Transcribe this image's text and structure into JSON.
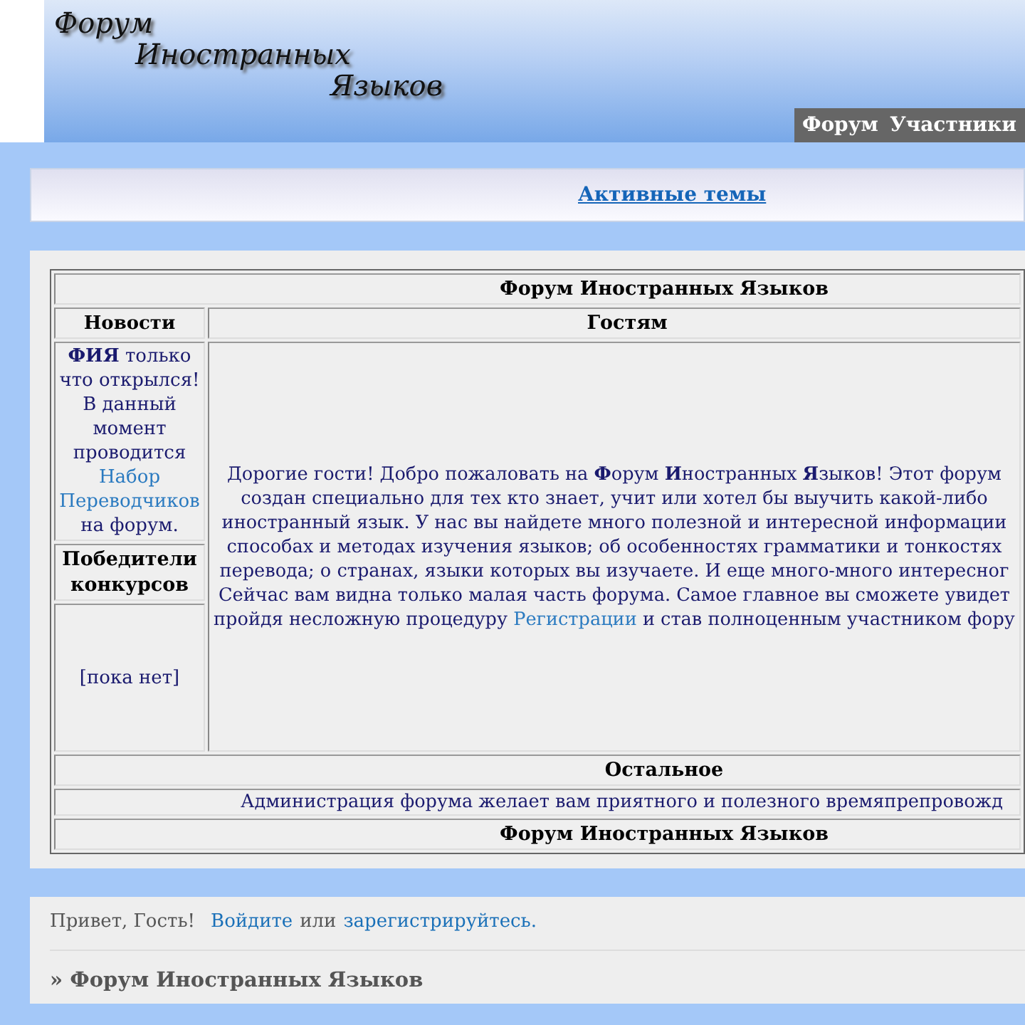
{
  "header": {
    "logo": [
      "Форум",
      "Иностранных",
      "Языков"
    ],
    "nav": [
      "Форум",
      "Участники"
    ]
  },
  "active_topics": "Активные темы",
  "table": {
    "title": "Форум Иностранных Языков",
    "columns": [
      "Новости",
      "Гостям"
    ],
    "news": {
      "before": "**ФИЯ** только что открылся! В данный момент проводится",
      "link": "Набор Переводчиков",
      "after": "на форум."
    },
    "winners_title": "Победители конкурсов",
    "winners": "[пока нет]",
    "welcome": {
      "before": "Дорогие гости! Добро пожаловать на **Ф**орум **И**ностранных **Я**зыков! Этот форум\nсоздан специально для тех кто знает, учит или хотел бы выучить какой-либо\nиностранный язык. У нас вы найдете много полезной и интересной информации\nспособах и методах изучения языков; об особенностях грамматики и тонкостях\nперевода; о странах, языки которых вы изучаете. И еще много-много интересног\nСейчас вам видна только малая часть форума. Самое главное вы сможете увидет\nпройдя несложную процедуру",
      "link": "Регистрации",
      "after": "и став полноценным участником фору"
    },
    "other_title": "Остальное",
    "other_text": "Администрация форума желает вам приятного и полезного времяпрепровожд",
    "footer_title": "Форум Иностранных Языков"
  },
  "footer": {
    "greeting": "Привет, Гость!",
    "login": "Войдите",
    "or": "или",
    "register": "зарегистрируйтесь.",
    "breadcrumb": "» Форум Иностранных Языков"
  }
}
